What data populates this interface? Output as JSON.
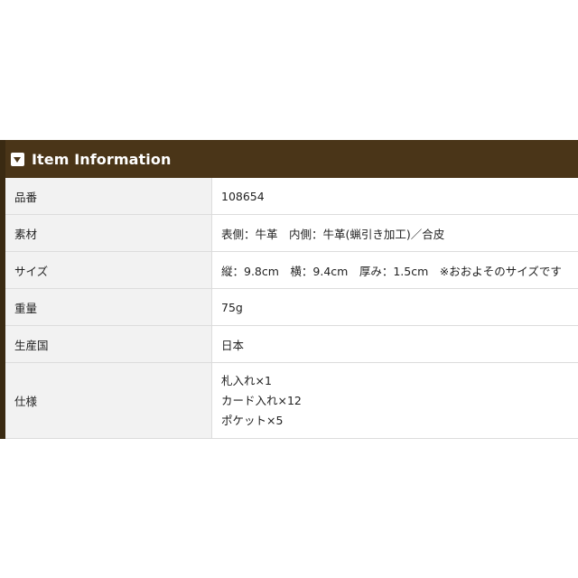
{
  "header": {
    "title": "Item Information",
    "icon": "caret-down-square-icon"
  },
  "rows": [
    {
      "label": "品番",
      "value": "108654"
    },
    {
      "label": "素材",
      "value": "表側：牛革　内側：牛革(蝋引き加工)／合皮"
    },
    {
      "label": "サイズ",
      "value": "縦：9.8cm　横：9.4cm　厚み：1.5cm　※おおよそのサイズです"
    },
    {
      "label": "重量",
      "value": "75g"
    },
    {
      "label": "生産国",
      "value": "日本"
    },
    {
      "label": "仕様",
      "lines": [
        "札入れ×1",
        "カード入れ×12",
        "ポケット×5"
      ]
    }
  ],
  "colors": {
    "header_bg": "#4a3518",
    "label_bg": "#f2f2f2",
    "border": "#dcdcdc"
  }
}
